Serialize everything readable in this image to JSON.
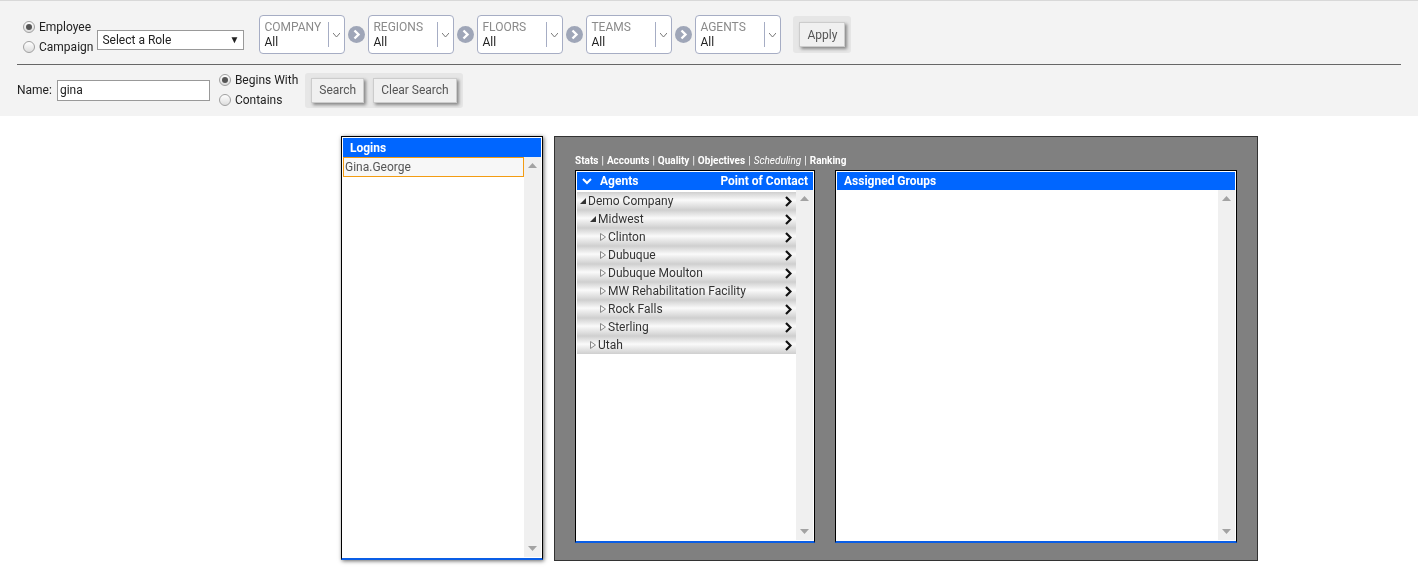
{
  "mode_options": [
    {
      "label": "Employee",
      "selected": true
    },
    {
      "label": "Campaign",
      "selected": false
    }
  ],
  "role_select": {
    "value": "Select a Role",
    "arrow": "▼"
  },
  "filters": [
    {
      "label": "COMPANY",
      "value": "All"
    },
    {
      "label": "REGIONS",
      "value": "All"
    },
    {
      "label": "FLOORS",
      "value": "All"
    },
    {
      "label": "TEAMS",
      "value": "All"
    },
    {
      "label": "AGENTS",
      "value": "All"
    }
  ],
  "apply_button": "Apply",
  "name_search": {
    "label": "Name:",
    "value": "gina"
  },
  "match_options": [
    {
      "label": "Begins With",
      "selected": true
    },
    {
      "label": "Contains",
      "selected": false
    }
  ],
  "search_buttons": [
    "Search",
    "Clear Search"
  ],
  "logins": {
    "title": "Logins",
    "items": [
      {
        "label": "Gina.George",
        "selected": true
      }
    ]
  },
  "nav_separator": "|",
  "nav_tabs": [
    {
      "label": "Stats",
      "selected": false
    },
    {
      "label": "Accounts",
      "selected": false
    },
    {
      "label": "Quality",
      "selected": false
    },
    {
      "label": "Objectives",
      "selected": false
    },
    {
      "label": "Scheduling",
      "selected": true
    },
    {
      "label": "Ranking",
      "selected": false
    }
  ],
  "agents_panel": {
    "title": "Agents",
    "right_title": "Point of Contact",
    "expanded": true,
    "tree": [
      {
        "label": "Demo Company",
        "expanded": true,
        "children": [
          {
            "label": "Midwest",
            "expanded": true,
            "children": [
              {
                "label": "Clinton",
                "expanded": false
              },
              {
                "label": "Dubuque",
                "expanded": false
              },
              {
                "label": "Dubuque Moulton",
                "expanded": false
              },
              {
                "label": "MW Rehabilitation Facility",
                "expanded": false
              },
              {
                "label": "Rock Falls",
                "expanded": false
              },
              {
                "label": "Sterling",
                "expanded": false
              }
            ]
          },
          {
            "label": "Utah",
            "expanded": false
          }
        ]
      }
    ]
  },
  "assigned_groups": {
    "title": "Assigned Groups"
  }
}
